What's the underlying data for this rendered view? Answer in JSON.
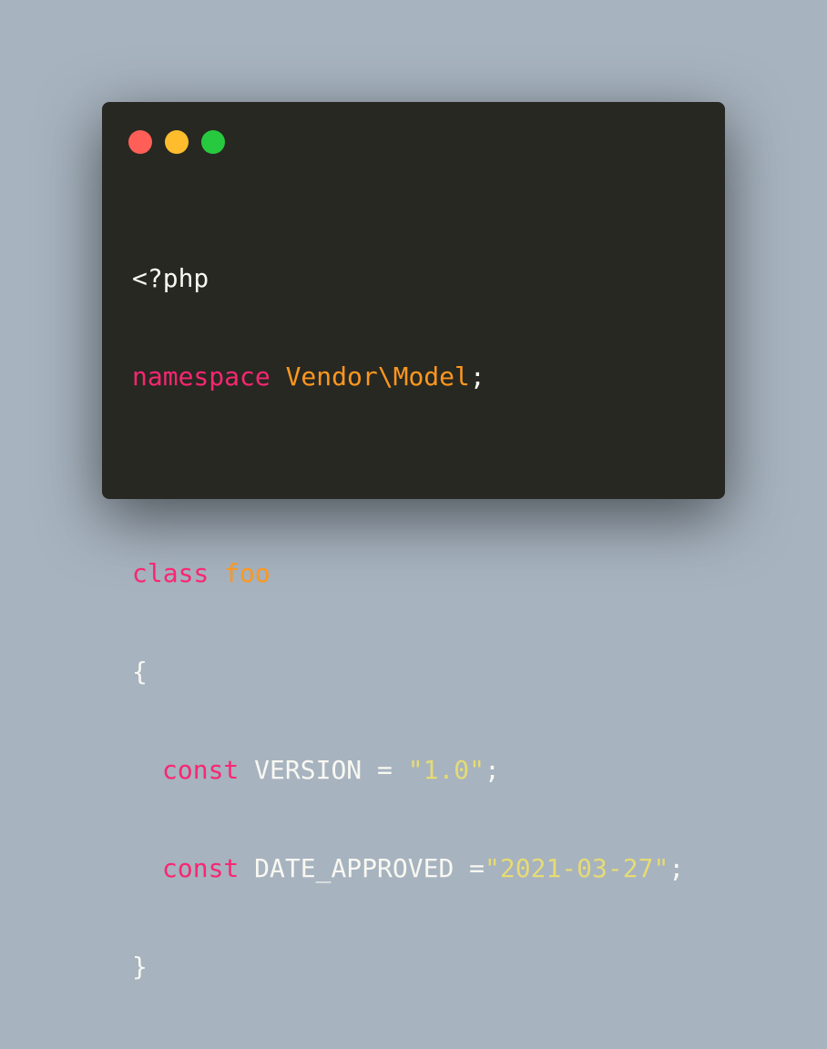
{
  "colors": {
    "background": "#a7b3bf",
    "editor": "#272822",
    "red_button": "#ff5f56",
    "yellow_button": "#ffbd2e",
    "green_button": "#27c93f",
    "plain": "#f8f8f2",
    "keyword": "#f92672",
    "name": "#fd971f",
    "string": "#e6db74"
  },
  "code": {
    "line1": {
      "open_tag": "<?php"
    },
    "line2": {
      "keyword": "namespace",
      "space": " ",
      "name": "Vendor\\Model",
      "semicolon": ";"
    },
    "line4": {
      "keyword": "class",
      "space": " ",
      "name": "foo"
    },
    "line5": {
      "brace": "{"
    },
    "line6": {
      "keyword": "const",
      "name": " VERSION = ",
      "value": "\"1.0\"",
      "semicolon": ";"
    },
    "line7": {
      "keyword": "const",
      "name": " DATE_APPROVED =",
      "value": "\"2021-03-27\"",
      "semicolon": ";"
    },
    "line8": {
      "brace": "}"
    }
  }
}
